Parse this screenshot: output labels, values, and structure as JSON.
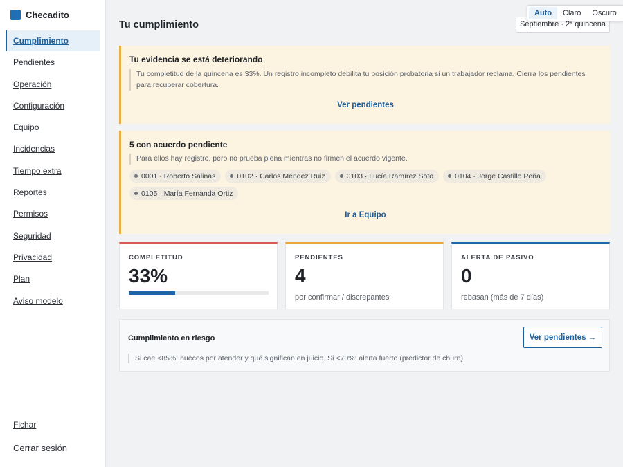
{
  "brand": {
    "name": "Checadito",
    "accent": "#1f6fb5"
  },
  "sidebar": {
    "items": [
      {
        "label": "Cumplimiento",
        "active": true
      },
      {
        "label": "Pendientes"
      },
      {
        "label": "Operación"
      },
      {
        "label": "Configuración"
      },
      {
        "label": "Equipo"
      },
      {
        "label": "Incidencias"
      },
      {
        "label": "Tiempo extra"
      },
      {
        "label": "Reportes"
      },
      {
        "label": "Permisos"
      },
      {
        "label": "Seguridad"
      },
      {
        "label": "Privacidad"
      },
      {
        "label": "Plan"
      },
      {
        "label": "Aviso modelo"
      }
    ],
    "footer": {
      "fichar": "Fichar",
      "logout": "Cerrar sesión"
    }
  },
  "theme": {
    "options": [
      "Auto",
      "Claro",
      "Oscuro"
    ],
    "selected": "Auto"
  },
  "header": {
    "title": "Tu cumplimiento",
    "period": "Septiembre · 2ª quincena"
  },
  "alerts": [
    {
      "title": "Tu evidencia se está deteriorando",
      "body": "Tu completitud de la quincena es 33%. Un registro incompleto debilita tu posición probatoria si un trabajador reclama. Cierra los pendientes para recuperar cobertura.",
      "link": "Ver pendientes"
    },
    {
      "title": "5 con acuerdo pendiente",
      "body": "Para ellos hay registro, pero no prueba plena mientras no firmen el acuerdo vigente.",
      "chips": [
        "0001 · Roberto Salinas",
        "0102 · Carlos Méndez Ruiz",
        "0103 · Lucía Ramírez Soto",
        "0104 · Jorge Castillo Peña",
        "0105 · María Fernanda Ortiz"
      ],
      "link": "Ir a Equipo"
    }
  ],
  "metrics": [
    {
      "label": "COMPLETITUD",
      "value": "33%",
      "progress": 0.33,
      "color": "#d95a52"
    },
    {
      "label": "PENDIENTES",
      "value": "4",
      "sub": "por confirmar / discrepantes",
      "color": "#e9a53a"
    },
    {
      "label": "ALERTA DE PASIVO",
      "value": "0",
      "sub": "rebasan (más de 7 días)",
      "color": "#1f63a8"
    }
  ],
  "risk": {
    "title": "Cumplimiento en riesgo",
    "button": "Ver pendientes →",
    "body": "Si cae <85%: huecos por atender y qué significan en juicio. Si <70%: alerta fuerte (predictor de churn)."
  }
}
